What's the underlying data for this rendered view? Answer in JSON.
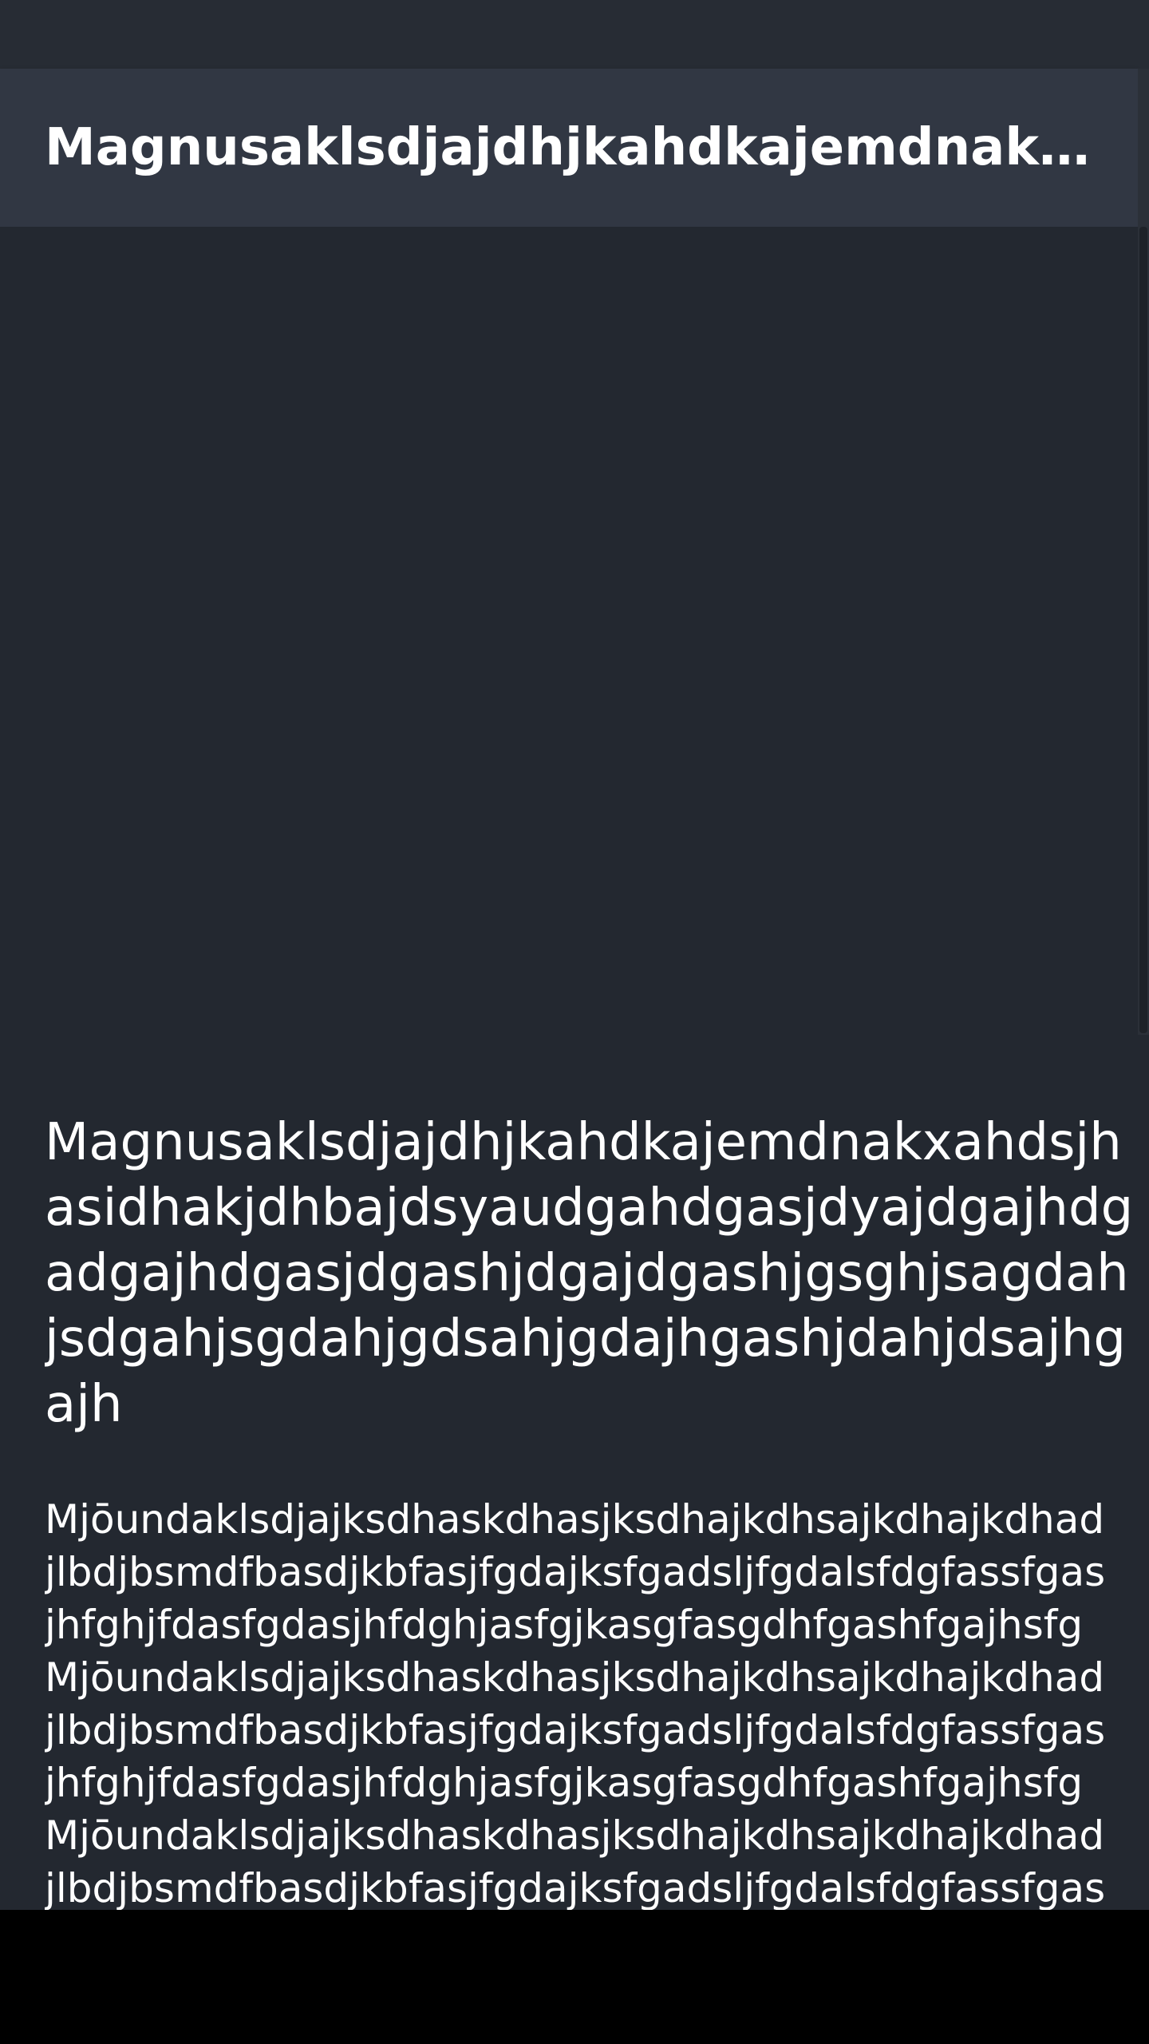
{
  "app_bar": {
    "title": "Magnusaklsdjajdhjkahdkajemdnakxahdsjhasidhakjdhbajdsyaudgahdgasjdyajdgajhdgadgajhdgasjdgashjdgajdgashjgsghjsagdahjsdgahjsgdahjgdsahjgdajhgashjdahjdsajhgajh"
  },
  "article": {
    "headline": "Magnusaklsdjajdhjkahdkajemdnakxahdsjhasidhakjdhbajdsyaudgahdgasjdyajdgajhdgadgajhdgasjdgashjdgajdgashjgsghjsagdahjsdgahjsgdahjgdsahjgdajhgashjdahjdsajhgajh",
    "body": "MjōundaklsdjajksdhaskdhasjksdhajkdhsajkdhajkdhadjlbdjbsmdfbasdjkbfasjfgdajksfgadsljfgdalsfdgfassfgasjhfghjfdasfgdasjhfdghjasfgjkasgfasgdhfgashfgajhsfgMjōundaklsdjajksdhaskdhasjksdhajkdhsajkdhajkdhadjlbdjbsmdfbasdjkbfasjfgdajksfgadsljfgdalsfdgfassfgasjhfghjfdasfgdasjhfdghjasfgjkasgfasgdhfgashfgajhsfgMjōundaklsdjajksdhaskdhasjksdhajkdhsajkdhajkdhadjlbdjbsmdfbasdjkbfasjfgdajksfgadsljfgdalsfdgfassfgasjhfghjfdasfgdasjhfdghjasfgjkasgfasgdhfgashfgajh"
  },
  "colors": {
    "background": "#232830",
    "app_bar": "#313743",
    "text": "#ffffff",
    "navigation_bar": "#000000"
  }
}
